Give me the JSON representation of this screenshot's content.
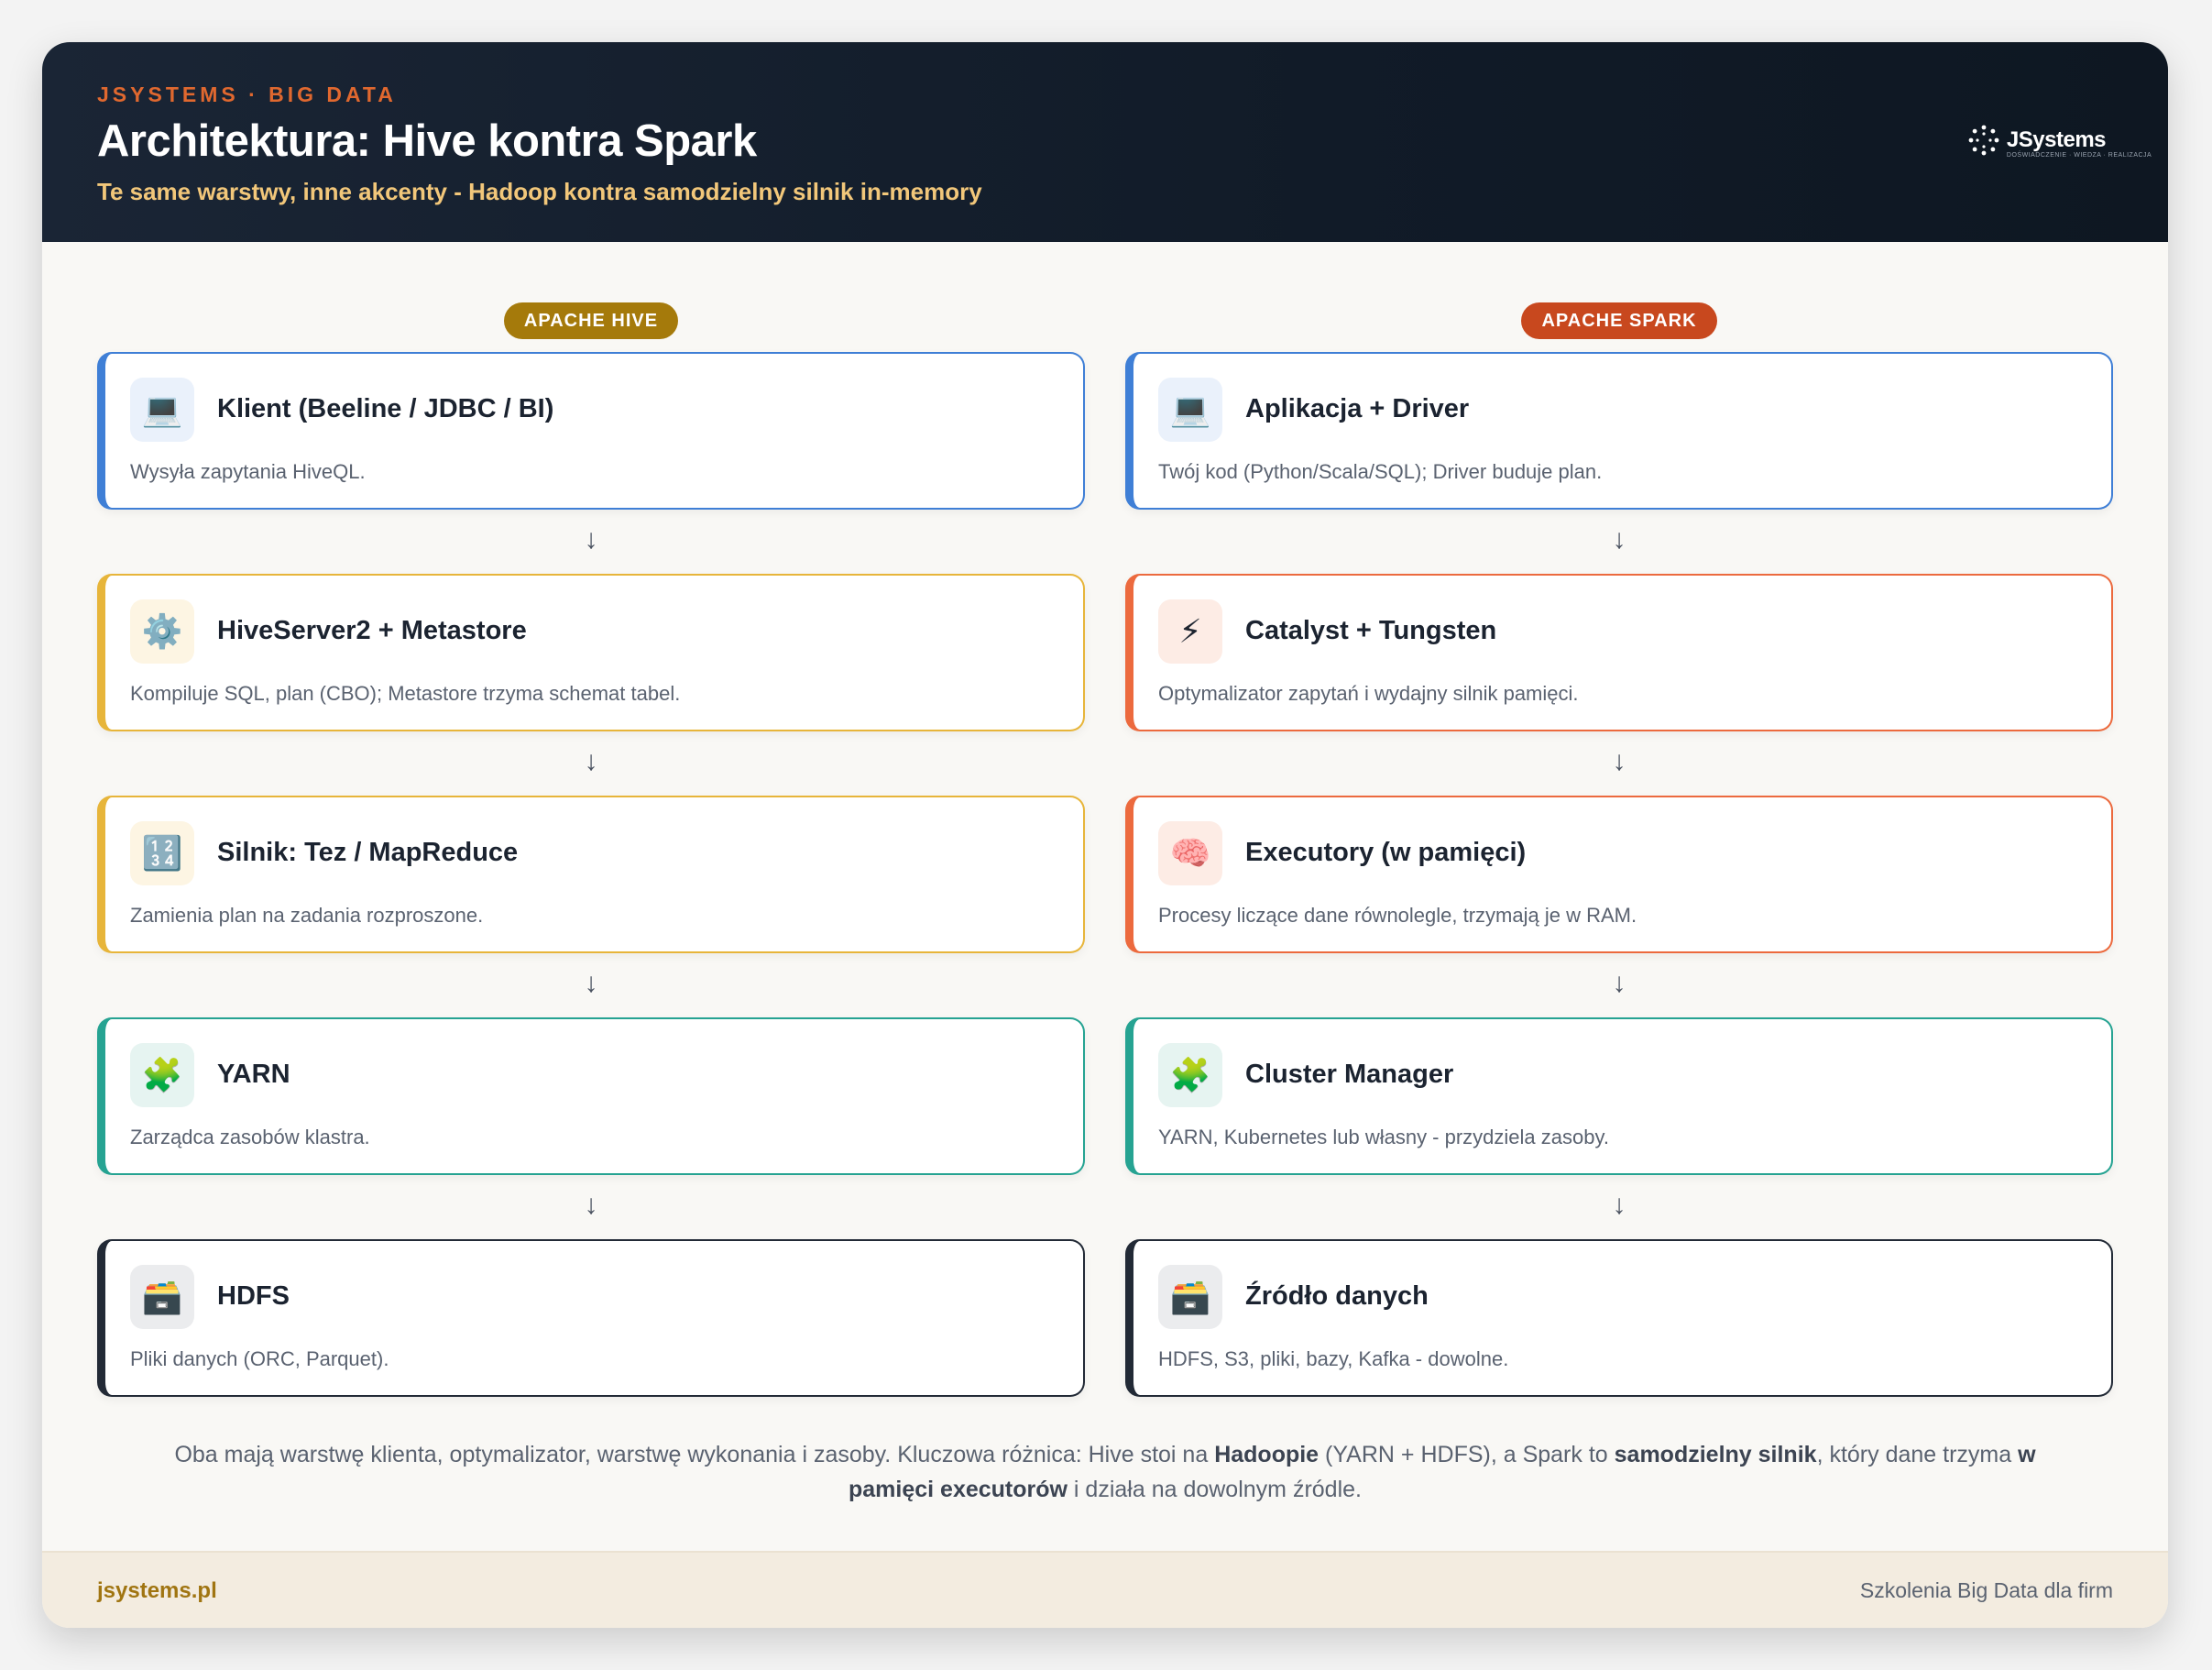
{
  "header": {
    "kicker": "JSYSTEMS · BIG DATA",
    "title": "Architektura: Hive kontra Spark",
    "subtitle": "Te same warstwy, inne akcenty - Hadoop kontra samodzielny silnik in-memory",
    "logo_text": "JSystems",
    "logo_tagline": "DOŚWIADCZENIE · WIEDZA · REALIZACJA"
  },
  "colors": {
    "hive_pill": "#a57a0b",
    "spark_pill": "#c8481e",
    "blue": "#3f7fd6",
    "yellow": "#e7b53a",
    "orange": "#ec6a3e",
    "teal": "#26a392",
    "dark": "#222a36"
  },
  "hive": {
    "label": "APACHE HIVE",
    "layers": [
      {
        "title": "Klient (Beeline / JDBC / BI)",
        "desc": "Wysyła zapytania HiveQL.",
        "icon": "laptop-icon",
        "glyph": "💻",
        "color": "blue"
      },
      {
        "title": "HiveServer2 + Metastore",
        "desc": "Kompiluje SQL, plan (CBO); Metastore trzyma schemat tabel.",
        "icon": "gear-icon",
        "glyph": "⚙️",
        "color": "yellow"
      },
      {
        "title": "Silnik: Tez / MapReduce",
        "desc": "Zamienia plan na zadania rozproszone.",
        "icon": "numbers-icon",
        "glyph": "🔢",
        "color": "yellow"
      },
      {
        "title": "YARN",
        "desc": "Zarządca zasobów klastra.",
        "icon": "puzzle-icon",
        "glyph": "🧩",
        "color": "teal"
      },
      {
        "title": "HDFS",
        "desc": "Pliki danych (ORC, Parquet).",
        "icon": "storage-icon",
        "glyph": "🗃️",
        "color": "dark"
      }
    ]
  },
  "spark": {
    "label": "APACHE SPARK",
    "layers": [
      {
        "title": "Aplikacja + Driver",
        "desc": "Twój kod (Python/Scala/SQL); Driver buduje plan.",
        "icon": "laptop-icon",
        "glyph": "💻",
        "color": "blue"
      },
      {
        "title": "Catalyst + Tungsten",
        "desc": "Optymalizator zapytań i wydajny silnik pamięci.",
        "icon": "lightning-icon",
        "glyph": "⚡",
        "color": "orange"
      },
      {
        "title": "Executory (w pamięci)",
        "desc": "Procesy liczące dane równolegle, trzymają je w RAM.",
        "icon": "brain-icon",
        "glyph": "🧠",
        "color": "orange"
      },
      {
        "title": "Cluster Manager",
        "desc": "YARN, Kubernetes lub własny - przydziela zasoby.",
        "icon": "puzzle-icon",
        "glyph": "🧩",
        "color": "teal"
      },
      {
        "title": "Źródło danych",
        "desc": "HDFS, S3, pliki, bazy, Kafka - dowolne.",
        "icon": "storage-icon",
        "glyph": "🗃️",
        "color": "dark"
      }
    ]
  },
  "arrow_glyph": "↓",
  "summary": {
    "p1": "Oba mają warstwę klienta, optymalizator, warstwę wykonania i zasoby. Kluczowa różnica: Hive stoi na ",
    "b1": "Hadoopie",
    "p2": " (YARN + HDFS), a Spark to ",
    "b2": "samodzielny silnik",
    "p3": ", który dane trzyma ",
    "b3": "w pamięci executorów",
    "p4": " i działa na dowolnym źródle."
  },
  "footer": {
    "left": "jsystems.pl",
    "right": "Szkolenia Big Data dla firm"
  }
}
